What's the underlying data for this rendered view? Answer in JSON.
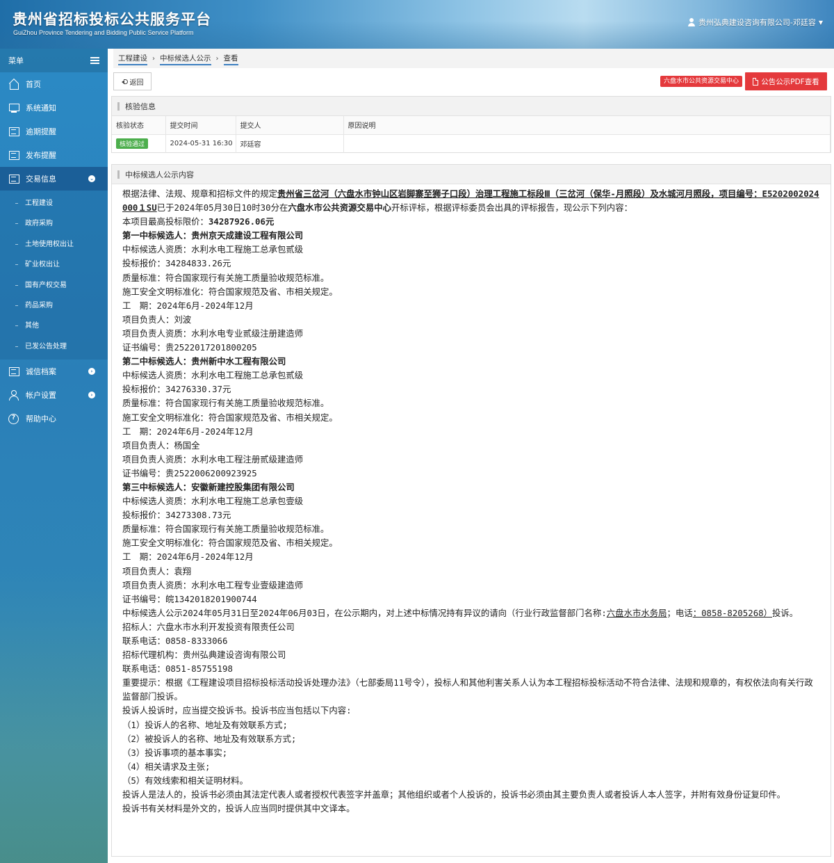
{
  "header": {
    "title": "贵州省招标投标公共服务平台",
    "subtitle": "GuiZhou Province Tendering and Bidding Public Service Platform",
    "user": "贵州弘典建设咨询有限公司-邓廷容"
  },
  "sidebar": {
    "menu_label": "菜单",
    "items": [
      {
        "label": "首页"
      },
      {
        "label": "系统通知"
      },
      {
        "label": "逾期提醒"
      },
      {
        "label": "发布提醒"
      },
      {
        "label": "交易信息"
      },
      {
        "label": "诚信档案"
      },
      {
        "label": "帐户设置"
      },
      {
        "label": "帮助中心"
      }
    ],
    "sub_items": [
      "工程建设",
      "政府采购",
      "土地使用权出让",
      "矿业权出让",
      "国有产权交易",
      "药品采购",
      "其他",
      "已发公告处理"
    ]
  },
  "breadcrumb": [
    "工程建设",
    "中标候选人公示",
    "查看"
  ],
  "toolbar": {
    "back_label": "返回",
    "center_tag": "六盘水市公共资源交易中心",
    "pdf_label": "公告公示PDF查看"
  },
  "verify": {
    "title": "核验信息",
    "headers": [
      "核验状态",
      "提交时间",
      "提交人",
      "原因说明"
    ],
    "row": {
      "status": "核验通过",
      "time": "2024-05-31 16:30",
      "submitter": "邓廷容",
      "reason": ""
    }
  },
  "notice": {
    "title": "中标候选人公示内容",
    "intro_prefix": "根据法律、法规、规章和招标文件的规定",
    "project_name": "贵州省三岔河（六盘水市钟山区岩脚寨至狮子口段）治理工程施工标段Ⅲ（三岔河（保华-月照段）及水城河月照段，项目编号：E5202002024000１SU",
    "intro_mid": "已于2024年05月30日10时30分在",
    "center": "六盘水市公共资源交易中心",
    "intro_suffix": "开标评标，根据评标委员会出具的评标报告，现公示下列内容：",
    "max_price_label": "本项目最高投标限价：",
    "max_price": "34287926.06元",
    "candidates": [
      {
        "heading": "第一中标候选人：贵州京天成建设工程有限公司",
        "qual": "中标候选人资质：水利水电工程施工总承包贰级",
        "price": "投标报价：34284833.26元",
        "quality": "质量标准：符合国家现行有关施工质量验收规范标准。",
        "safety": "施工安全文明标准化：符合国家规范及省、市相关规定。",
        "period": "工　期：2024年6月-2024年12月",
        "manager": "项目负责人：刘波",
        "manager_qual": "项目负责人资质：水利水电专业贰级注册建造师",
        "cert": "证书编号：贵2522017201800205"
      },
      {
        "heading": "第二中标候选人：贵州新中水工程有限公司",
        "qual": "中标候选人资质：水利水电工程施工总承包贰级",
        "price": "投标报价：34276330.37元",
        "quality": "质量标准：符合国家现行有关施工质量验收规范标准。",
        "safety": "施工安全文明标准化：符合国家规范及省、市相关规定。",
        "period": "工　期：2024年6月-2024年12月",
        "manager": "项目负责人：杨国全",
        "manager_qual": "项目负责人资质：水利水电工程注册贰级建造师",
        "cert": "证书编号：贵2522006200923925"
      },
      {
        "heading": "第三中标候选人：安徽新建控股集团有限公司",
        "qual": "中标候选人资质：水利水电工程施工总承包壹级",
        "price": "投标报价：34273308.73元",
        "quality": "质量标准：符合国家现行有关施工质量验收规范标准。",
        "safety": "施工安全文明标准化：符合国家规范及省、市相关规定。",
        "period": "工　期：2024年6月-2024年12月",
        "manager": "项目负责人：袁翔",
        "manager_qual": "项目负责人资质：水利水电工程专业壹级建造师",
        "cert": "证书编号：皖1342018201900744"
      }
    ],
    "period_text_prefix": "中标候选人公示2024年05月31日至2024年06月03日，在公示期内，对上述中标情况持有异议的请向（行业行政监督部门名称:",
    "supervisor": "六盘水市水务局",
    "phone_label": "；电话",
    "phone": "：0858-8205268）",
    "period_text_suffix": "投诉。",
    "tenderer": "招标人：六盘水市水利开发投资有限责任公司",
    "tenderer_phone": "联系电话：0858-8333066",
    "agent": "招标代理机构：贵州弘典建设咨询有限公司",
    "agent_phone": "联系电话：0851-85755198",
    "important": "重要提示：根据《工程建设项目招标投标活动投诉处理办法》（七部委局11号令），投标人和其他利害关系人认为本工程招标投标活动不符合法律、法规和规章的，有权依法向有关行政监督部门投诉。",
    "complaint_intro": "投诉人投诉时，应当提交投诉书。投诉书应当包括以下内容:",
    "complaint_items": [
      "（1）投诉人的名称、地址及有效联系方式;",
      "（2）被投诉人的名称、地址及有效联系方式;",
      "（3）投诉事项的基本事实;",
      "（4）相关请求及主张;",
      "（5）有效线索和相关证明材料。"
    ],
    "legal_person": "投诉人是法人的，投诉书必须由其法定代表人或者授权代表签字并盖章；其他组织或者个人投诉的，投诉书必须由其主要负责人或者投诉人本人签字，并附有效身份证复印件。",
    "foreign": "投诉书有关材料是外文的，投诉人应当同时提供其中文译本。"
  }
}
